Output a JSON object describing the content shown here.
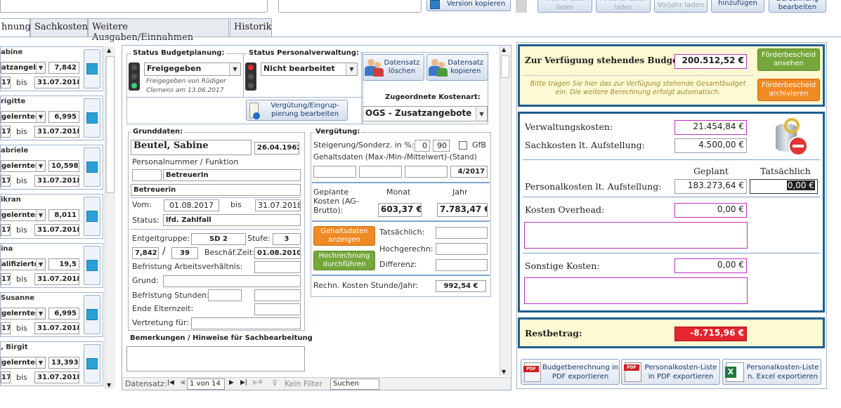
{
  "toolbar": {
    "version_copy": "Version kopieren",
    "dim_btn1": "Personal daten laden",
    "dim_btn2": "Personal daten laden",
    "prev_year": "Vorjahr laden",
    "add": "hinzufügen",
    "edit_calc": "Berechnung bearbeiten"
  },
  "tabs": [
    "Rechnung",
    "Sachkosten",
    "Weitere Ausgaben/Einnahmen",
    "Historik"
  ],
  "tabs_visible": [
    "hnung",
    "Sachkosten",
    "Weitere Ausgaben/Einnahmen",
    "Historik"
  ],
  "persons": [
    {
      "name": "abine",
      "group": "atzangeb",
      "val": "7,842",
      "d1": "17",
      "bis": "bis",
      "d2": "31.07.2018"
    },
    {
      "name": "rigitte",
      "group": "gelerntes I",
      "val": "6,995",
      "d1": "17",
      "bis": "bis",
      "d2": "31.07.2018"
    },
    {
      "name": "abriele",
      "group": "gelerntes I",
      "val": "10,598",
      "d1": "17",
      "bis": "bis",
      "d2": "31.07.2018"
    },
    {
      "name": "ikran",
      "group": "gelerntes I",
      "val": "8,011",
      "d1": "17",
      "bis": "bis",
      "d2": "31.07.2018"
    },
    {
      "name": "ina",
      "group": "alifiziertes",
      "val": "19,5",
      "d1": "17",
      "bis": "bis",
      "d2": "31.07.2018"
    },
    {
      "name": "Susanne",
      "group": "gelerntes I",
      "val": "6,995",
      "d1": "17",
      "bis": "bis",
      "d2": "31.07.2018"
    },
    {
      "name": ", Birgit",
      "group": "gelerntes I",
      "val": "13,393",
      "d1": "17",
      "bis": "bis",
      "d2": "31.07.2018"
    }
  ],
  "status": {
    "budget_label": "Status Budgetplanung:",
    "budget_value": "Freigegeben",
    "budget_note": "Freigegeben von Rüdiger Clemens am 13.06.2017",
    "personal_label": "Status Personalverwaltung:",
    "personal_value": "Nicht bearbeitet",
    "delete_btn": "Datensatz löschen",
    "copy_btn": "Datensatz kopieren",
    "verguetung_btn": "Vergütung/Eingrup-pierung bearbeiten",
    "kostenart_label": "Zugeordnete Kostenart:",
    "kostenart_value": "OGS - Zusatzangebote"
  },
  "grunddaten": {
    "title": "Grunddaten:",
    "name": "Beutel, Sabine",
    "birth": "26.04.1962",
    "persnr_label": "Personalnummer / Funktion",
    "function": "BetreuerIn",
    "function2": "Betreuerin",
    "vom_label": "Vom:",
    "vom": "01.08.2017",
    "bis_label": "bis",
    "bis": "31.07.2018",
    "status_label": "Status:",
    "status": "lfd. Zahlfall",
    "eg_label": "Entgeltgruppe:",
    "eg": "SD 2",
    "stufe_label": "Stufe:",
    "stufe": "3",
    "h1": "7,842",
    "slash": "/",
    "h2": "39",
    "beschzeit_label": "Beschäf.Zeit:",
    "beschzeit": "01.08.2010",
    "befr_label": "Befristung Arbeitsverhältnis:",
    "grund_label": "Grund:",
    "befr_std_label": "Befristung Stunden:",
    "eltern_label": "Ende Elternzeit:",
    "vertretung_label": "Vertretung für:"
  },
  "bemerkungen_label": "Bemerkungen / Hinweise für Sachbearbeitung",
  "verguetung": {
    "title": "Vergütung:",
    "steig_label": "Steigerung/Sonderz. in %:",
    "steig1": "0",
    "steig2": "90",
    "gfb": "GfB",
    "gehalt_label": "Gehaltsdaten (Max-/Min-/Mittelwert)-(Stand)",
    "stand": "4/2017",
    "geplante_label": "Geplante Kosten (AG-Brutto):",
    "monat_label": "Monat",
    "jahr_label": "Jahr",
    "monat": "603,37 €",
    "jahr": "7.783,47 €",
    "gehaltsdaten_btn": "Gehaltsdaten anzeigen",
    "hochrechnung_btn": "Hochrechnung durchführen",
    "tats_label": "Tatsächlich:",
    "hoch_label": "Hochgerechn:",
    "diff_label": "Differenz:",
    "rechn_label": "Rechn. Kosten Stunde/Jahr:",
    "rechn": "992,54 €"
  },
  "nav": {
    "label": "Datensatz:",
    "pos": "1 von 14",
    "filter": "Kein Filter",
    "search": "Suchen"
  },
  "budget": {
    "label": "Zur Verfügung stehendes Budget:",
    "value": "200.512,52 €",
    "foerder_btn": "Förderbescheid ansehen",
    "archiv_btn": "Förderbescheid archivieren",
    "hint": "Bitte tragen Sie hier das zur Verfügung stehende Gesamtbudget ein. Die weitere Berechnung erfolgt automatisch."
  },
  "costs": {
    "verwaltung_label": "Verwaltungskosten:",
    "verwaltung": "21.454,84 €",
    "sach_label": "Sachkosten lt. Aufstellung:",
    "sach": "4.500,00 €",
    "geplant_label": "Geplant",
    "tats_label": "Tatsächlich",
    "personal_label": "Personalkosten lt. Aufstellung:",
    "personal_geplant": "183.273,64 €",
    "personal_tats": "0,00 €",
    "overhead_label": "Kosten Overhead:",
    "overhead": "0,00 €",
    "sonstige_label": "Sonstige Kosten:",
    "sonstige": "0,00 €"
  },
  "rest": {
    "label": "Restbetrag:",
    "value": "-8.715,96 €"
  },
  "export": {
    "pdf1": "Budgetberechnung in PDF exportieren",
    "pdf2": "Personalkosten-Liste in PDF exportieren",
    "xls": "Personalkosten-Liste n. Excel exportieren"
  },
  "colors": {
    "panel_border": "#1f5e8e",
    "yellow": "#fdf9d2",
    "green_btn": "#76a73a",
    "orange_btn": "#f08a24",
    "rest_red": "#e3262f",
    "magenta_border": "#c030c0"
  }
}
